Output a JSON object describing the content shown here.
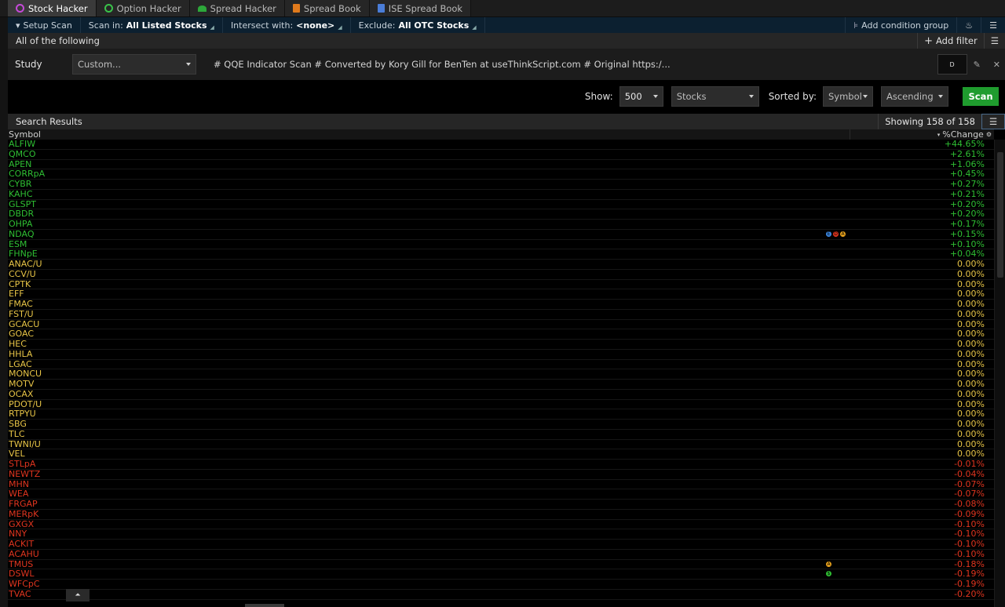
{
  "tabs": [
    {
      "label": "Stock Hacker",
      "icon": "stock-hacker-icon",
      "active": true
    },
    {
      "label": "Option Hacker",
      "icon": "option-hacker-icon",
      "active": false
    },
    {
      "label": "Spread Hacker",
      "icon": "spread-hacker-icon",
      "active": false
    },
    {
      "label": "Spread Book",
      "icon": "spread-book-icon",
      "active": false
    },
    {
      "label": "ISE Spread Book",
      "icon": "ise-spread-book-icon",
      "active": false
    }
  ],
  "setup": {
    "setup_scan": "Setup Scan",
    "scan_in_label": "Scan in:",
    "scan_in_value": "All Listed Stocks",
    "intersect_label": "Intersect with:",
    "intersect_value": "<none>",
    "exclude_label": "Exclude:",
    "exclude_value": "All OTC Stocks",
    "add_condition_group": "Add condition group"
  },
  "filter": {
    "all_following": "All of the following",
    "add_filter": "Add filter"
  },
  "study": {
    "label": "Study",
    "dropdown_value": "Custom...",
    "formula": "# QQE Indicator Scan # Converted by Kory Gill for BenTen at useThinkScript.com # Original https:/...",
    "aggregation": "D"
  },
  "show": {
    "label": "Show:",
    "count": "500",
    "type": "Stocks",
    "sorted_label": "Sorted by:",
    "sorted_value": "Symbol",
    "order": "Ascending",
    "scan_button": "Scan"
  },
  "results": {
    "title": "Search Results",
    "showing": "Showing 158 of 158",
    "col_symbol": "Symbol",
    "col_change": "%Change"
  },
  "colors": {
    "positive": "#2fbf33",
    "zero": "#e8c547",
    "negative": "#e0351f",
    "scan_button": "#1f9c2e"
  },
  "rows": [
    {
      "symbol": "ALFIW",
      "change": "+44.65%",
      "trend": "pos"
    },
    {
      "symbol": "QMCO",
      "change": "+2.61%",
      "trend": "pos"
    },
    {
      "symbol": "APEN",
      "change": "+1.06%",
      "trend": "pos"
    },
    {
      "symbol": "CORRpA",
      "change": "+0.45%",
      "trend": "pos"
    },
    {
      "symbol": "CYBR",
      "change": "+0.27%",
      "trend": "pos"
    },
    {
      "symbol": "KAHC",
      "change": "+0.21%",
      "trend": "pos"
    },
    {
      "symbol": "GLSPT",
      "change": "+0.20%",
      "trend": "pos"
    },
    {
      "symbol": "DBDR",
      "change": "+0.20%",
      "trend": "pos"
    },
    {
      "symbol": "OHPA",
      "change": "+0.17%",
      "trend": "pos"
    },
    {
      "symbol": "NDAQ",
      "change": "+0.15%",
      "trend": "pos",
      "badges": [
        {
          "color": "#3a86e0",
          "glyph": "E"
        },
        {
          "color": "#e0351f",
          "glyph": "D"
        },
        {
          "color": "#e8a21c",
          "glyph": "A"
        }
      ]
    },
    {
      "symbol": "ESM",
      "change": "+0.10%",
      "trend": "pos"
    },
    {
      "symbol": "FHNpE",
      "change": "+0.04%",
      "trend": "pos"
    },
    {
      "symbol": "ANAC/U",
      "change": "0.00%",
      "trend": "zero"
    },
    {
      "symbol": "CCV/U",
      "change": "0.00%",
      "trend": "zero"
    },
    {
      "symbol": "CPTK",
      "change": "0.00%",
      "trend": "zero"
    },
    {
      "symbol": "EFF",
      "change": "0.00%",
      "trend": "zero"
    },
    {
      "symbol": "FMAC",
      "change": "0.00%",
      "trend": "zero"
    },
    {
      "symbol": "FST/U",
      "change": "0.00%",
      "trend": "zero"
    },
    {
      "symbol": "GCACU",
      "change": "0.00%",
      "trend": "zero"
    },
    {
      "symbol": "GOAC",
      "change": "0.00%",
      "trend": "zero"
    },
    {
      "symbol": "HEC",
      "change": "0.00%",
      "trend": "zero"
    },
    {
      "symbol": "HHLA",
      "change": "0.00%",
      "trend": "zero"
    },
    {
      "symbol": "LGAC",
      "change": "0.00%",
      "trend": "zero"
    },
    {
      "symbol": "MONCU",
      "change": "0.00%",
      "trend": "zero"
    },
    {
      "symbol": "MOTV",
      "change": "0.00%",
      "trend": "zero"
    },
    {
      "symbol": "OCAX",
      "change": "0.00%",
      "trend": "zero"
    },
    {
      "symbol": "PDOT/U",
      "change": "0.00%",
      "trend": "zero"
    },
    {
      "symbol": "RTPYU",
      "change": "0.00%",
      "trend": "zero"
    },
    {
      "symbol": "SBG",
      "change": "0.00%",
      "trend": "zero"
    },
    {
      "symbol": "TLC",
      "change": "0.00%",
      "trend": "zero"
    },
    {
      "symbol": "TWNI/U",
      "change": "0.00%",
      "trend": "zero"
    },
    {
      "symbol": "VEL",
      "change": "0.00%",
      "trend": "zero"
    },
    {
      "symbol": "STLpA",
      "change": "-0.01%",
      "trend": "neg"
    },
    {
      "symbol": "NEWTZ",
      "change": "-0.04%",
      "trend": "neg"
    },
    {
      "symbol": "MHN",
      "change": "-0.07%",
      "trend": "neg"
    },
    {
      "symbol": "WEA",
      "change": "-0.07%",
      "trend": "neg"
    },
    {
      "symbol": "FRGAP",
      "change": "-0.08%",
      "trend": "neg"
    },
    {
      "symbol": "MERpK",
      "change": "-0.09%",
      "trend": "neg"
    },
    {
      "symbol": "GXGX",
      "change": "-0.10%",
      "trend": "neg"
    },
    {
      "symbol": "NNY",
      "change": "-0.10%",
      "trend": "neg"
    },
    {
      "symbol": "ACKIT",
      "change": "-0.10%",
      "trend": "neg"
    },
    {
      "symbol": "ACAHU",
      "change": "-0.10%",
      "trend": "neg"
    },
    {
      "symbol": "TMUS",
      "change": "-0.18%",
      "trend": "neg",
      "badges": [
        {
          "color": "#e8a21c",
          "glyph": "A"
        }
      ]
    },
    {
      "symbol": "DSWL",
      "change": "-0.19%",
      "trend": "neg",
      "badges": [
        {
          "color": "#2fbf33",
          "glyph": "$"
        }
      ]
    },
    {
      "symbol": "WFCpC",
      "change": "-0.19%",
      "trend": "neg"
    },
    {
      "symbol": "TVAC",
      "change": "-0.20%",
      "trend": "neg"
    }
  ]
}
